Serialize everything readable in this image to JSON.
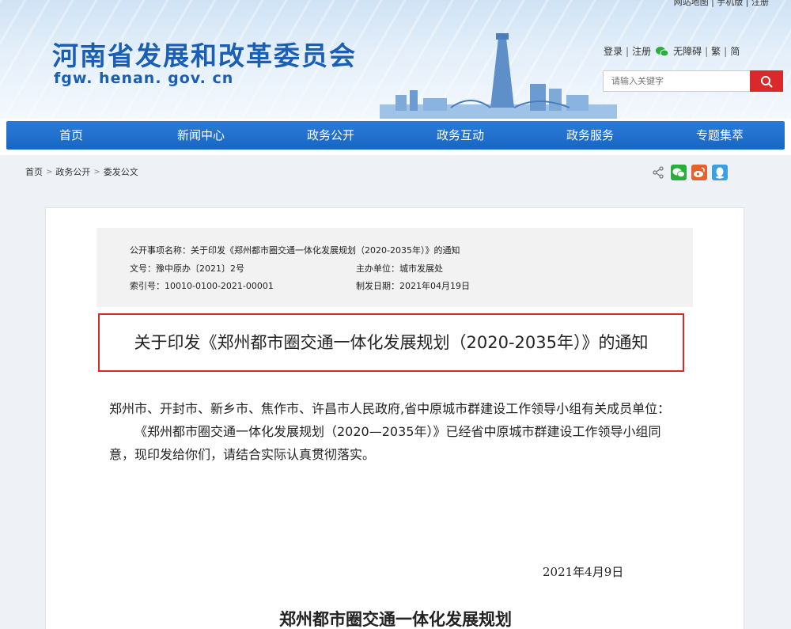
{
  "header": {
    "top_sliver": "网站地图 | 手机版 | 注册",
    "site_title": "河南省发展和改革委员会",
    "site_domain": "fgw. henan. gov. cn",
    "links": {
      "login": "登录",
      "register": "注册",
      "accessibility": "无障碍",
      "traditional": "繁",
      "simplified": "简"
    },
    "search_placeholder": "请输入关键字",
    "search_icon": "search-icon"
  },
  "nav": {
    "items": [
      {
        "label": "首页"
      },
      {
        "label": "新闻中心"
      },
      {
        "label": "政务公开"
      },
      {
        "label": "政务互动"
      },
      {
        "label": "政务服务"
      },
      {
        "label": "专题集萃"
      }
    ]
  },
  "breadcrumb": {
    "items": [
      "首页",
      "政务公开",
      "委发公文"
    ],
    "separator": ">"
  },
  "share": {
    "icons": [
      "share-icon",
      "wechat-icon",
      "weibo-icon",
      "qq-icon"
    ],
    "colors": {
      "wechat": "#2aae3b",
      "weibo": "#e8612c",
      "qq": "#3aa0e0"
    }
  },
  "meta": {
    "subject_label": "公开事项名称：",
    "subject_value": "关于印发《郑州都市圈交通一体化发展规划（2020-2035年）》的通知",
    "doc_no_label": "文号：",
    "doc_no_value": "豫中原办〔2021〕2号",
    "dept_label": "主办单位：",
    "dept_value": "城市发展处",
    "index_label": "索引号：",
    "index_value": "10010-0100-2021-00001",
    "date_label": "制发日期：",
    "date_value": "2021年04月19日"
  },
  "article": {
    "title": "关于印发《郑州都市圈交通一体化发展规划（2020-2035年）》的通知",
    "addressee": "郑州市、开封市、新乡市、焦作市、许昌市人民政府,省中原城市群建设工作领导小组有关成员单位：",
    "body": "《郑州都市圈交通一体化发展规划（2020—2035年）》已经省中原城市群建设工作领导小组同意，现印发给你们，请结合实际认真贯彻落实。",
    "sign_date": "2021年4月9日",
    "attachment_heading": "郑州都市圈交通一体化发展规划"
  },
  "colors": {
    "brand_blue": "#1a5fb4",
    "nav_blue": "#1866c4",
    "accent_red": "#d9292a"
  }
}
